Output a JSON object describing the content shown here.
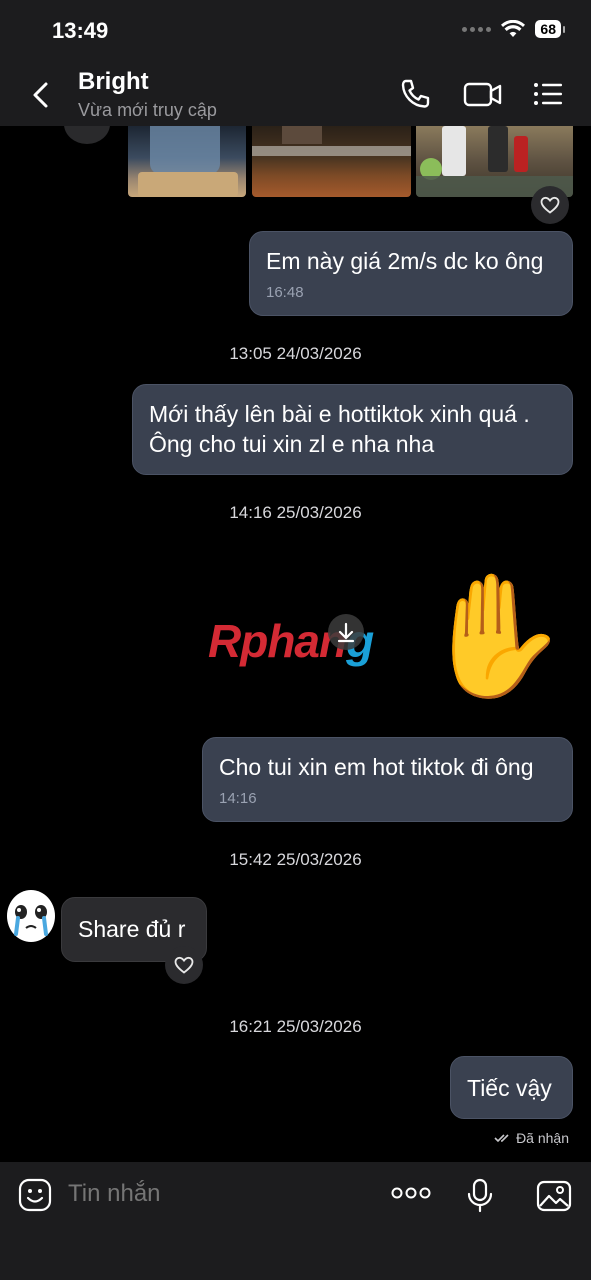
{
  "status_bar": {
    "time": "13:49",
    "battery": "68"
  },
  "header": {
    "name": "Bright",
    "status": "Vừa mới truy cập"
  },
  "messages": [
    {
      "text": "Em này giá 2m/s dc ko ông",
      "time": "16:48"
    },
    {
      "text_line1": "Mới thấy lên bài e hottiktok xinh quá .",
      "text_line2": "Ông cho tui xin zl e nha nha"
    },
    {
      "text": "Cho tui xin em hot tiktok đi ông",
      "time": "14:16"
    },
    {
      "text": "Share đủ r"
    },
    {
      "text": "Tiếc vậy"
    }
  ],
  "date_separators": [
    "13:05 24/03/2026",
    "14:16 25/03/2026",
    "15:42 25/03/2026",
    "16:21 25/03/2026"
  ],
  "sticker": {
    "emoji": "✋"
  },
  "watermark": {
    "part1": "Rphan",
    "part2": "g"
  },
  "delivered_label": "Đã nhận",
  "composer": {
    "placeholder": "Tin nhắn"
  },
  "colors": {
    "outgoing_bubble": "#3a4150",
    "incoming_bubble": "#2b2b2e",
    "header_bg": "#1c1c1e"
  }
}
